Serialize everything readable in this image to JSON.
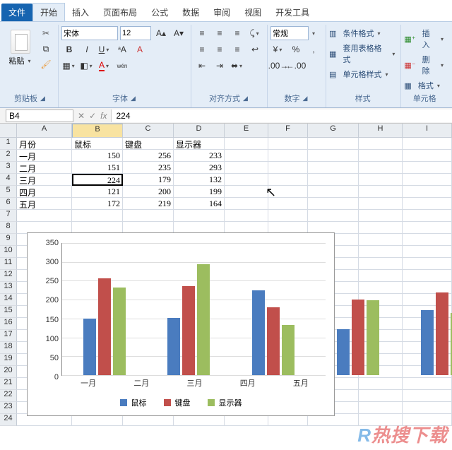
{
  "tabs": {
    "file": "文件",
    "items": [
      "开始",
      "插入",
      "页面布局",
      "公式",
      "数据",
      "审阅",
      "视图",
      "开发工具"
    ],
    "activeIndex": 0
  },
  "ribbon": {
    "clipboard": {
      "title": "剪贴板",
      "paste": "粘贴"
    },
    "font": {
      "title": "字体",
      "name": "宋体",
      "size": "12"
    },
    "align": {
      "title": "对齐方式"
    },
    "number": {
      "title": "数字",
      "format": "常规"
    },
    "styles": {
      "title": "样式",
      "cond": "条件格式",
      "table": "套用表格格式",
      "cell": "单元格样式"
    },
    "cells": {
      "title": "单元格",
      "insert": "插入",
      "delete": "删除",
      "format": "格式"
    }
  },
  "formula": {
    "nameRef": "B4",
    "fxLabel": "fx",
    "value": "224"
  },
  "sheet": {
    "cols": [
      "",
      "A",
      "B",
      "C",
      "D",
      "E",
      "F",
      "G",
      "H",
      "I"
    ],
    "rows": [
      {
        "h": "1",
        "cells": [
          "月份",
          "鼠标",
          "键盘",
          "显示器",
          "",
          "",
          "",
          "",
          ""
        ]
      },
      {
        "h": "2",
        "cells": [
          "一月",
          "150",
          "256",
          "233",
          "",
          "",
          "",
          "",
          ""
        ]
      },
      {
        "h": "3",
        "cells": [
          "二月",
          "151",
          "235",
          "293",
          "",
          "",
          "",
          "",
          ""
        ]
      },
      {
        "h": "4",
        "cells": [
          "三月",
          "224",
          "179",
          "132",
          "",
          "",
          "",
          "",
          ""
        ]
      },
      {
        "h": "5",
        "cells": [
          "四月",
          "121",
          "200",
          "199",
          "",
          "",
          "",
          "",
          ""
        ]
      },
      {
        "h": "6",
        "cells": [
          "五月",
          "172",
          "219",
          "164",
          "",
          "",
          "",
          "",
          ""
        ]
      },
      {
        "h": "7",
        "cells": [
          "",
          "",
          "",
          "",
          "",
          "",
          "",
          "",
          ""
        ]
      },
      {
        "h": "8",
        "cells": [
          "",
          "",
          "",
          "",
          "",
          "",
          "",
          "",
          ""
        ]
      },
      {
        "h": "9",
        "cells": [
          "",
          "",
          "",
          "",
          "",
          "",
          "",
          "",
          ""
        ]
      },
      {
        "h": "10",
        "cells": [
          "",
          "",
          "",
          "",
          "",
          "",
          "",
          "",
          ""
        ]
      },
      {
        "h": "11",
        "cells": [
          "",
          "",
          "",
          "",
          "",
          "",
          "",
          "",
          ""
        ]
      },
      {
        "h": "12",
        "cells": [
          "",
          "",
          "",
          "",
          "",
          "",
          "",
          "",
          ""
        ]
      },
      {
        "h": "13",
        "cells": [
          "",
          "",
          "",
          "",
          "",
          "",
          "",
          "",
          ""
        ]
      },
      {
        "h": "14",
        "cells": [
          "",
          "",
          "",
          "",
          "",
          "",
          "",
          "",
          ""
        ]
      },
      {
        "h": "15",
        "cells": [
          "",
          "",
          "",
          "",
          "",
          "",
          "",
          "",
          ""
        ]
      },
      {
        "h": "16",
        "cells": [
          "",
          "",
          "",
          "",
          "",
          "",
          "",
          "",
          ""
        ]
      },
      {
        "h": "17",
        "cells": [
          "",
          "",
          "",
          "",
          "",
          "",
          "",
          "",
          ""
        ]
      },
      {
        "h": "18",
        "cells": [
          "",
          "",
          "",
          "",
          "",
          "",
          "",
          "",
          ""
        ]
      },
      {
        "h": "19",
        "cells": [
          "",
          "",
          "",
          "",
          "",
          "",
          "",
          "",
          ""
        ]
      },
      {
        "h": "20",
        "cells": [
          "",
          "",
          "",
          "",
          "",
          "",
          "",
          "",
          ""
        ]
      },
      {
        "h": "21",
        "cells": [
          "",
          "",
          "",
          "",
          "",
          "",
          "",
          "",
          ""
        ]
      },
      {
        "h": "22",
        "cells": [
          "",
          "",
          "",
          "",
          "",
          "",
          "",
          "",
          ""
        ]
      },
      {
        "h": "23",
        "cells": [
          "",
          "",
          "",
          "",
          "",
          "",
          "",
          "",
          ""
        ]
      },
      {
        "h": "24",
        "cells": [
          "",
          "",
          "",
          "",
          "",
          "",
          "",
          "",
          ""
        ]
      }
    ],
    "selected": {
      "row": 3,
      "col": 1
    }
  },
  "chart_data": {
    "type": "bar",
    "categories": [
      "一月",
      "二月",
      "三月",
      "四月",
      "五月"
    ],
    "series": [
      {
        "name": "鼠标",
        "color": "#4a7cbf",
        "values": [
          150,
          151,
          224,
          121,
          172
        ]
      },
      {
        "name": "键盘",
        "color": "#c14f4b",
        "values": [
          256,
          235,
          179,
          200,
          219
        ]
      },
      {
        "name": "显示器",
        "color": "#9cbd5f",
        "values": [
          233,
          293,
          132,
          199,
          164
        ]
      }
    ],
    "ylim": [
      0,
      350
    ],
    "yticks": [
      0,
      50,
      100,
      150,
      200,
      250,
      300,
      350
    ]
  },
  "watermark": {
    "r": "R",
    "text": "热搜下载"
  }
}
